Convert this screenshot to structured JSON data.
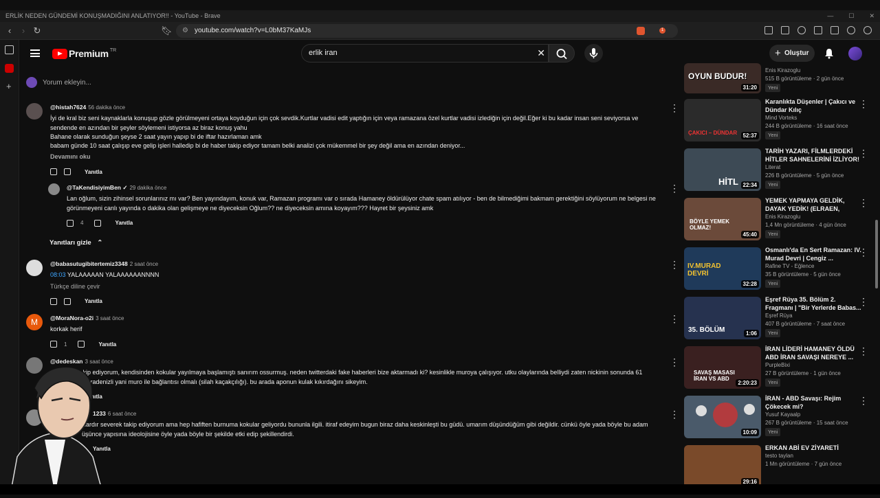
{
  "window": {
    "title": "ERLİK NEDEN GÜNDEMİ KONUŞMADIĞINI ANLATIYOR!! - YouTube - Brave"
  },
  "browser": {
    "url": "youtube.com/watch?v=L0bM37KaMJs",
    "brave_badge": "1"
  },
  "header": {
    "logo": "Premium",
    "logo_region": "TR",
    "search_value": "erlik iran",
    "create_label": "Oluştur"
  },
  "add_comment": {
    "placeholder": "Yorum ekleyin..."
  },
  "comments": [
    {
      "user": "@histah7624",
      "time": "56 dakika önce",
      "text": "İyi de kral biz seni kaynaklarla konuşup gözle görülmeyeni ortaya koyduğun için çok sevdik.Kurtlar vadisi edit yaptığın için veya ramazana özel kurtlar vadisi izlediğin için değil.Eğer ki bu kadar insan seni seviyorsa ve\nsendende en azından bir şeyler söylemeni istiyorsa az biraz konuş yahu\nBahane olarak sunduğun şeyse 2 saat yayın yapıp bi de iftar hazırlaman amk\nbabam günde 10 saat çalışıp eve gelip işleri halledip bi de haber takip ediyor tamam belki analizi çok mükemmel bir şey değil ama en azından deniyor...",
      "more": "Devamını oku",
      "reply": "Yanıtla",
      "likes": ""
    },
    {
      "user": "@TaKendisiyimBen ✓",
      "time": "29 dakika önce",
      "text": "Lan oğlum, sizin zihinsel sorunlarınız mı var? Ben yayındayım, konuk var, Ramazan programı var o sırada Hamaney öldürülüyor chate spam atılıyor - ben de bilmediğimi bakmam gerektiğini söylüyorum ne belgesi ne\ngörünmeyeni canlı yayında o dakika olan gelişmeye ne diyeceksin Oğlum?? ne diyeceksin amına koyayım??? Hayret bir şeysiniz amk",
      "reply": "Yanıtla",
      "likes": "4"
    },
    {
      "user": "@babasutugibitertemiz3348",
      "time": "2 saat önce",
      "timestamp": "08:03",
      "text": "YALAAAAAN YALAAAAAANNNN",
      "translate": "Türkçe diline çevir",
      "reply": "Yanıtla",
      "likes": ""
    },
    {
      "user": "@MoraNora-o2i",
      "time": "3 saat önce",
      "text": "korkak herif",
      "reply": "Yanıtla",
      "likes": "1",
      "avatar_letter": "M"
    },
    {
      "user": "@dedeskan",
      "time": "3 saat önce",
      "text": "takip ediyorum, kendisinden kokular yayılmaya başlamıştı sanırım ossurmuş. neden twitterdaki fake haberleri bize aktarmadı ki? kesinlikle muroya çalışıyor. utku olaylarında belliydi zaten nickinin sonunda 61\nsi karadenizli yani muro ile bağlantısı olmalı (silah kaçakçılığı). bu arada aponun kulak kıkırdağını sikeyim.",
      "reply": "Yanıtla"
    },
    {
      "user": "1233",
      "time": "6 saat önce",
      "text": "illardır severek takip ediyorum ama hep hafiften burnuma kokular geliyordu bununla ilgili. itiraf edeyim bugun biraz daha keskinleşti bu güdü. umarım düşündüğüm gibi değildir. cünkü öyle yada böyle bu adam\nüşünce yapısına ideolojisine öyle yada böyle bir şekilde etki edip şekillendirdi.",
      "reply": "Yanıtla"
    }
  ],
  "hide_replies": "Yanıtları gizle",
  "sidebar": {
    "videos": [
      {
        "title": "",
        "channel": "Enis Kirazoglu",
        "views": "515 B görüntüleme · 2 gün önce",
        "new": "Yeni",
        "duration": "31:20",
        "thumb_text": "OYUN BUDUR!",
        "color": "#3a2a26"
      },
      {
        "title": "Karanlıkta Düşenler | Çakıcı ve Dündar Kılıç",
        "channel": "Mind Vorteks",
        "views": "244 B görüntüleme · 16 saat önce",
        "new": "Yeni",
        "duration": "52:37",
        "thumb_text": "ÇAKICI – DÜNDAR",
        "color": "#2b2b2b"
      },
      {
        "title": "TARİH YAZARI, FİLMLERDEKİ HİTLER SAHNELERİNİ İZLİYOR!",
        "channel": "Literat",
        "views": "226 B görüntüleme · 5 gün önce",
        "new": "Yeni",
        "duration": "22:34",
        "thumb_text": "HİTL",
        "color": "#3d4a55"
      },
      {
        "title": "YEMEK YAPMAYA GELDİK, DAYAK YEDİK! (ELRAEN, ERAY,...",
        "channel": "Enis Kirazoglu",
        "views": "1,4 Mn görüntüleme · 4 gün önce",
        "new": "Yeni",
        "duration": "45:40",
        "thumb_text": "BÖYLE YEMEK OLMAZ!",
        "color": "#6b4a3a"
      },
      {
        "title": "Osmanlı'da En Sert Ramazan: IV. Murad Devri | Cengiz ...",
        "channel": "Rafine TV - Eğlence",
        "views": "35 B görüntüleme · 5 gün önce",
        "new": "Yeni",
        "duration": "32:28",
        "thumb_text": "IV.MURAD DEVRİ",
        "color": "#1f3a5a"
      },
      {
        "title": "Eşref Rüya 35. Bölüm 2. Fragmanı | \"Bir Yerlerde Babas...",
        "channel": "Eşref Rüya",
        "views": "407 B görüntüleme · 7 saat önce",
        "new": "Yeni",
        "duration": "1:06",
        "thumb_text": "35. BÖLÜM",
        "color": "#26324f"
      },
      {
        "title": "İRAN LİDERİ HAMANEY ÖLDÜ ABD İRAN SAVAŞI NEREYE ...",
        "channel": "PurpleBixi",
        "views": "27 B görüntüleme · 1 gün önce",
        "new": "Yeni",
        "duration": "2:20:23",
        "thumb_text": "SAVAŞ MASASI İRAN VS ABD",
        "color": "#3a2020"
      },
      {
        "title": "İRAN - ABD Savaşı: Rejim Çökecek mi?",
        "channel": "Yusuf Kayaalp",
        "views": "267 B görüntüleme · 15 saat önce",
        "new": "Yeni",
        "duration": "10:09",
        "thumb_text": "",
        "color": "#4a5a6a"
      },
      {
        "title": "ERKAN ABİ EV ZİYARETİ",
        "channel": "testo taylan",
        "views": "1 Mn görüntüleme · 7 gün önce",
        "new": "",
        "duration": "29:16",
        "thumb_text": "",
        "color": "#7a4a2a"
      }
    ]
  }
}
